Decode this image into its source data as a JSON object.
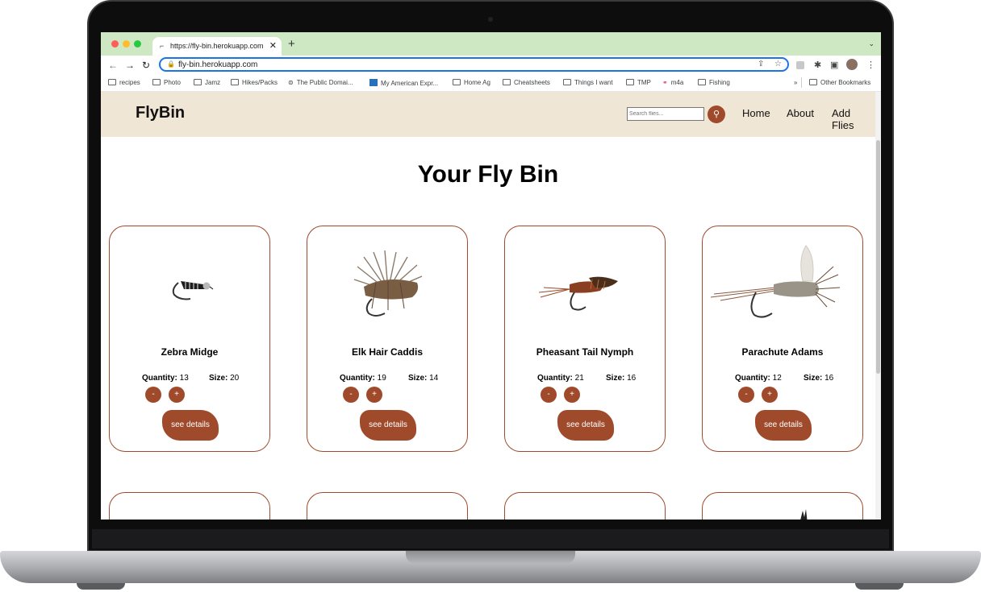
{
  "browser": {
    "tab_title": "https://fly-bin.herokuapp.com",
    "tab_close": "✕",
    "new_tab": "+",
    "url": "fly-bin.herokuapp.com",
    "bookmarks": [
      "recipes",
      "Photo",
      "Jamz",
      "Hikes/Packs",
      "The Public Domai...",
      "My American Expr...",
      "Home Ag",
      "Cheatsheets",
      "Things I want",
      "TMP",
      "m4a",
      "Fishing"
    ],
    "bookmarks_overflow": "»",
    "other_bookmarks": "Other Bookmarks"
  },
  "site": {
    "logo": "FlyBin",
    "search_placeholder": "Search flies...",
    "nav": [
      "Home",
      "About",
      "Add Flies"
    ],
    "heading": "Your Fly Bin",
    "quantity_label": "Quantity:",
    "size_label": "Size:",
    "decrement": "-",
    "increment": "+",
    "details_label": "see details",
    "flies": [
      {
        "name": "Zebra Midge",
        "quantity": "13",
        "size": "20"
      },
      {
        "name": "Elk Hair Caddis",
        "quantity": "19",
        "size": "14"
      },
      {
        "name": "Pheasant Tail Nymph",
        "quantity": "21",
        "size": "16"
      },
      {
        "name": "Parachute Adams",
        "quantity": "12",
        "size": "16"
      }
    ]
  },
  "colors": {
    "accent": "#a04a2c",
    "header_bg": "#f0e6d5",
    "tab_bar": "#cfe8c4",
    "focus": "#1a73e8"
  },
  "icons": [
    "back-icon",
    "forward-icon",
    "reload-icon",
    "lock-icon",
    "share-icon",
    "star-icon",
    "extensions-icon",
    "sidebar-icon",
    "menu-icon",
    "search-icon"
  ]
}
